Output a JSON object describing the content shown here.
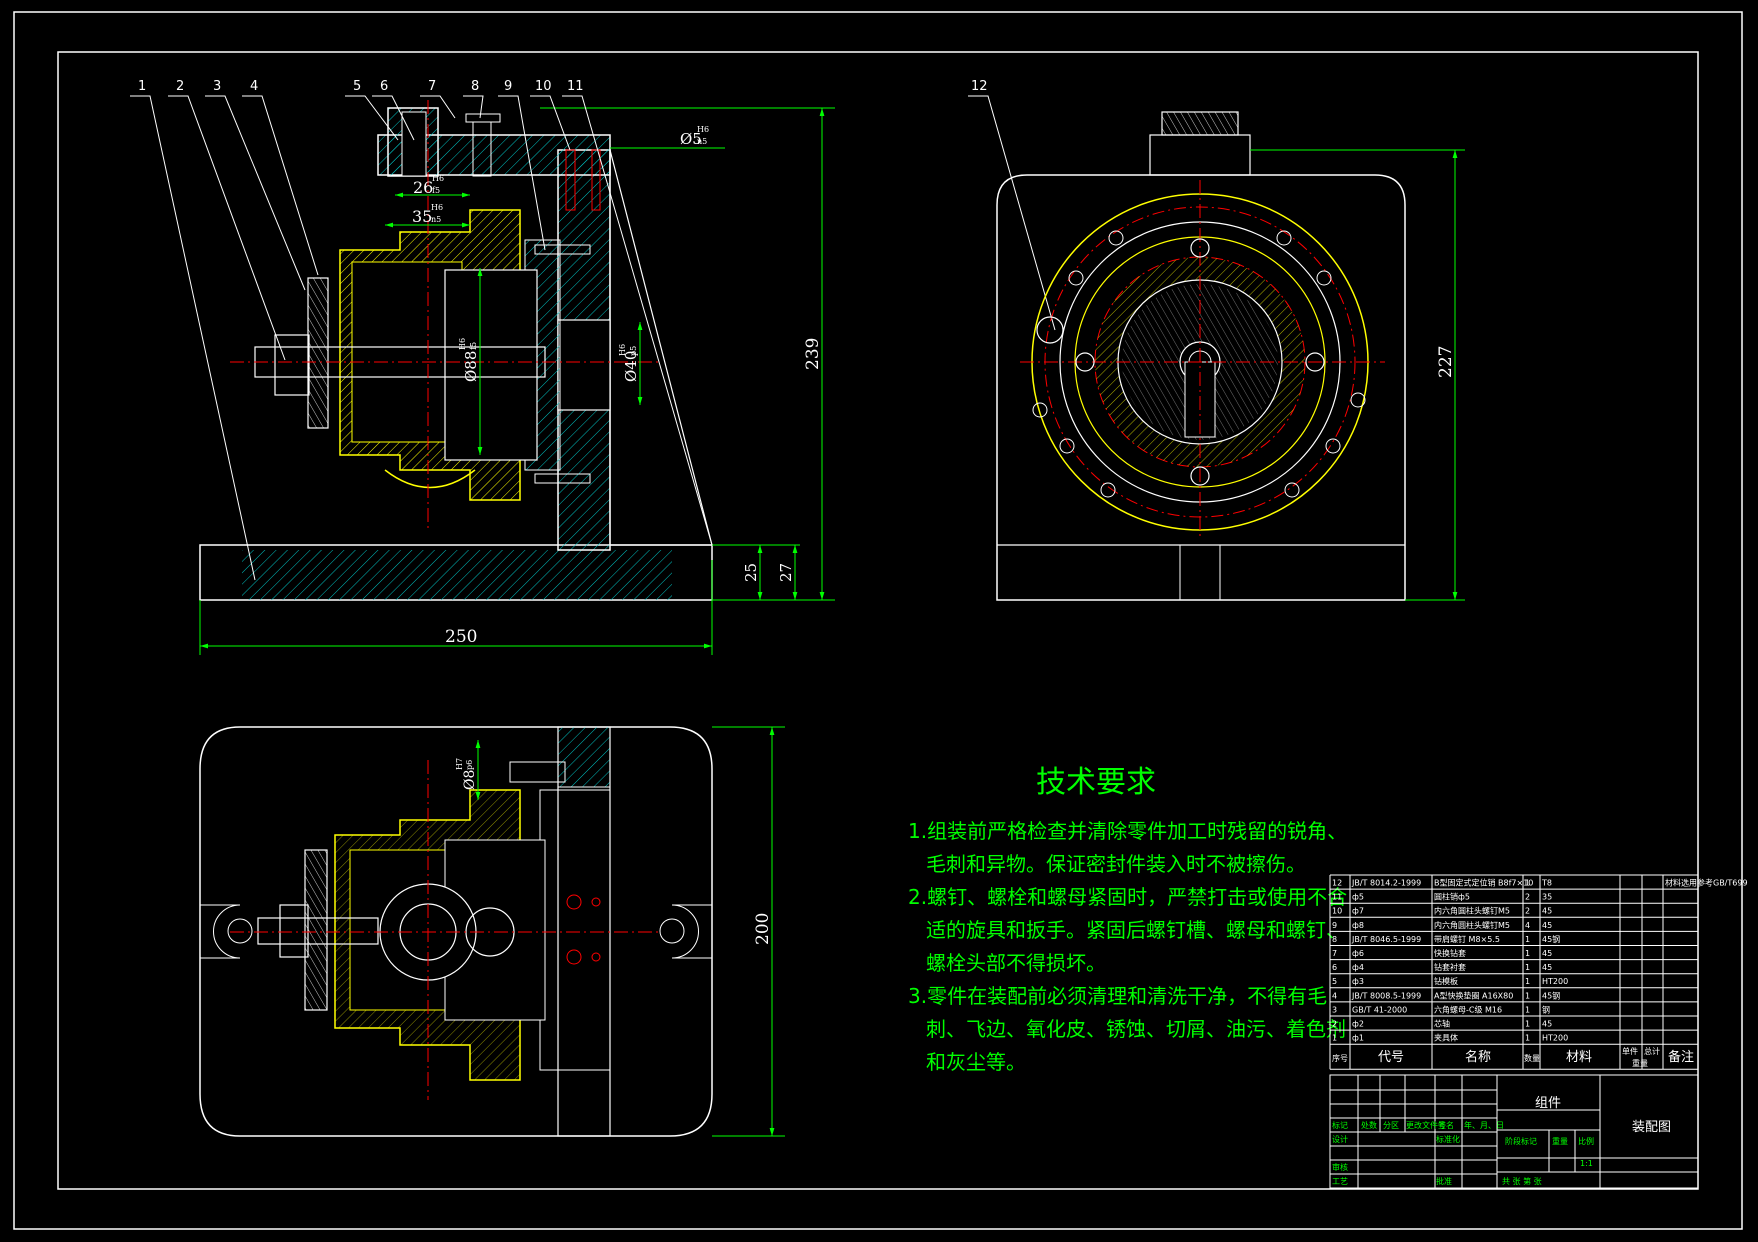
{
  "colors": {
    "background": "#000000",
    "outline": "#ffffff",
    "hatch": "#00c0c0",
    "dimension": "#00ff00",
    "centerline": "#ff0000",
    "body_part": "#ffff00",
    "text": "#00ff00"
  },
  "balloons": [
    "1",
    "2",
    "3",
    "4",
    "5",
    "6",
    "7",
    "8",
    "9",
    "10",
    "11",
    "12"
  ],
  "dimensions": {
    "d250": "250",
    "d239": "239",
    "d227": "227",
    "d200": "200",
    "d25": "25",
    "d27": "27",
    "d26": "26",
    "d26_up": "H6",
    "d26_lo": "f5",
    "d35": "35",
    "d35_up": "H6",
    "d35_lo": "n5",
    "d5": "Ø5",
    "d5_up": "H6",
    "d5_lo": "n5",
    "d88": "Ø88",
    "d88_up": "H6",
    "d88_lo": "f5",
    "d40": "Ø40",
    "d40_up": "H6",
    "d40_lo": "p5",
    "d8": "Ø8",
    "d8_up": "H7",
    "d8_lo": "p6"
  },
  "requirements": {
    "title": "技术要求",
    "lines": [
      "1.组装前严格检查并清除零件加工时残留的锐角、",
      "毛刺和异物。保证密封件装入时不被擦伤。",
      "2.螺钉、螺栓和螺母紧固时，严禁打击或使用不合",
      "适的旋具和扳手。紧固后螺钉槽、螺母和螺钉、",
      "螺栓头部不得损坏。",
      "3.零件在装配前必须清理和清洗干净，不得有毛",
      "刺、飞边、氧化皮、锈蚀、切屑、油污、着色剂",
      "和灰尘等。"
    ]
  },
  "bom": {
    "rows": [
      [
        "12",
        "JB/T 8014.2-1999",
        "B型固定式定位销 B8f7×10",
        "1",
        "T8",
        "",
        "",
        "材料选用参考GB/T699"
      ],
      [
        "11",
        "ф5",
        "圆柱销ф5",
        "2",
        "35",
        "",
        "",
        ""
      ],
      [
        "10",
        "ф7",
        "内六角圆柱头螺钉M5",
        "2",
        "45",
        "",
        "",
        ""
      ],
      [
        "9",
        "ф8",
        "内六角圆柱头螺钉M5",
        "4",
        "45",
        "",
        "",
        ""
      ],
      [
        "8",
        "JB/T 8046.5-1999",
        "带肩螺钉 M8×5.5",
        "1",
        "45钢",
        "",
        "",
        ""
      ],
      [
        "7",
        "ф6",
        "快换钻套",
        "1",
        "45",
        "",
        "",
        ""
      ],
      [
        "6",
        "ф4",
        "钻套衬套",
        "1",
        "45",
        "",
        "",
        ""
      ],
      [
        "5",
        "ф3",
        "钻模板",
        "1",
        "HT200",
        "",
        "",
        ""
      ],
      [
        "4",
        "JB/T 8008.5-1999",
        "A型快换垫圈 A16X80",
        "1",
        "45钢",
        "",
        "",
        ""
      ],
      [
        "3",
        "GB/T 41-2000",
        "六角螺母-C级 M16",
        "1",
        "钢",
        "",
        "",
        ""
      ],
      [
        "2",
        "ф2",
        "芯轴",
        "1",
        "45",
        "",
        "",
        ""
      ],
      [
        "1",
        "ф1",
        "夹具体",
        "1",
        "HT200",
        "",
        "",
        ""
      ]
    ],
    "header": {
      "seq": "序号",
      "code": "代号",
      "name": "名称",
      "qty": "数量",
      "material": "材料",
      "unit": "单件",
      "total": "总计",
      "weight": "重量",
      "remark": "备注"
    }
  },
  "title_block": {
    "group": "组件",
    "drawing_name": "装配图",
    "sign_labels": [
      "标记",
      "处数",
      "分区",
      "更改文件号",
      "签名",
      "年、月、日"
    ],
    "design": "设计",
    "standard": "标准化",
    "stage": "阶段标记",
    "weight": "重量",
    "scale": "比例",
    "scale_value": "1:1",
    "check": "审核",
    "process": "工艺",
    "approve": "批准",
    "sheets": "共   张   第   张"
  }
}
